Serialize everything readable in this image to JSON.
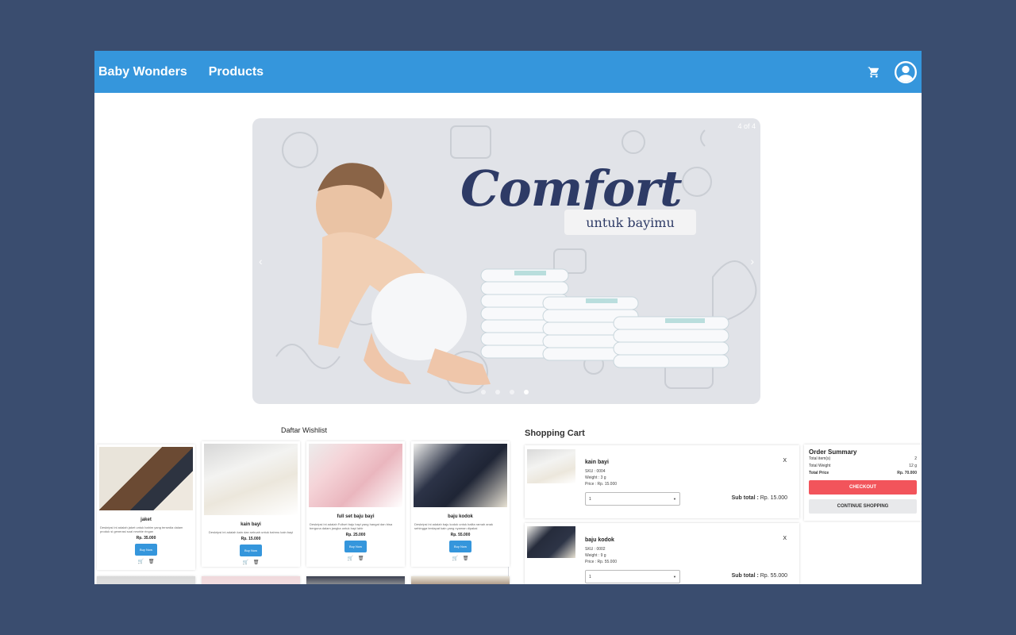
{
  "nav": {
    "brand": "Baby Wonders",
    "products": "Products",
    "cart_icon": "cart-icon",
    "account_icon": "account-circle-icon"
  },
  "carousel": {
    "counter": "4 of 4",
    "title": "Comfort",
    "subtitle": "untuk bayimu",
    "prev": "‹",
    "next": "›",
    "slide_count": 4,
    "active_slide": 4
  },
  "wishlist": {
    "title": "Daftar Wishlist",
    "buy_label": "Buy Now",
    "items": [
      {
        "name": "jaket",
        "desc": "Deskripsi ini adalah jaket untuk bahim yang tersedia dalam produk si generasi soal newbie ringan",
        "price": "Rp. 35.000"
      },
      {
        "name": "kain bayi",
        "desc": "Deskripsi ini adalah kain dan sebuah untuk bahmu kain bayi",
        "price": "Rp. 15.000"
      },
      {
        "name": "full set baju bayi",
        "desc": "Deskripsi ini adalah Fullset baju bayi yang hangat dan bisa berguna dalam jangka untuk bayi lahir",
        "price": "Rp. 25.000"
      },
      {
        "name": "baju kodok",
        "desc": "Deskripsi ini adalah baju kodok untuk balita ramah anak sehingga terdapat kain yang nyaman dipakai",
        "price": "Rp. 55.000"
      }
    ]
  },
  "cart": {
    "title": "Shopping Cart",
    "items": [
      {
        "name": "kain bayi",
        "sku": "SKU : 0004",
        "weight": "Weight : 3 g",
        "price": "Price : Rp. 15.000",
        "qty": "1",
        "remove": "X",
        "subtotal_label": "Sub total :",
        "subtotal": "Rp. 15.000"
      },
      {
        "name": "baju kodok",
        "sku": "SKU : 0002",
        "weight": "Weight : 9 g",
        "price": "Price : Rp. 55.000",
        "qty": "1",
        "remove": "X",
        "subtotal_label": "Sub total :",
        "subtotal": "Rp. 55.000"
      }
    ]
  },
  "summary": {
    "title": "Order Summary",
    "total_items_label": "Total item(s)",
    "total_items": "2",
    "total_weight_label": "Total Weight",
    "total_weight": "12 g",
    "total_price_label": "Total Price",
    "total_price": "Rp. 70.000",
    "checkout": "CHECKOUT",
    "continue": "CONTINUE SHOPPING"
  }
}
